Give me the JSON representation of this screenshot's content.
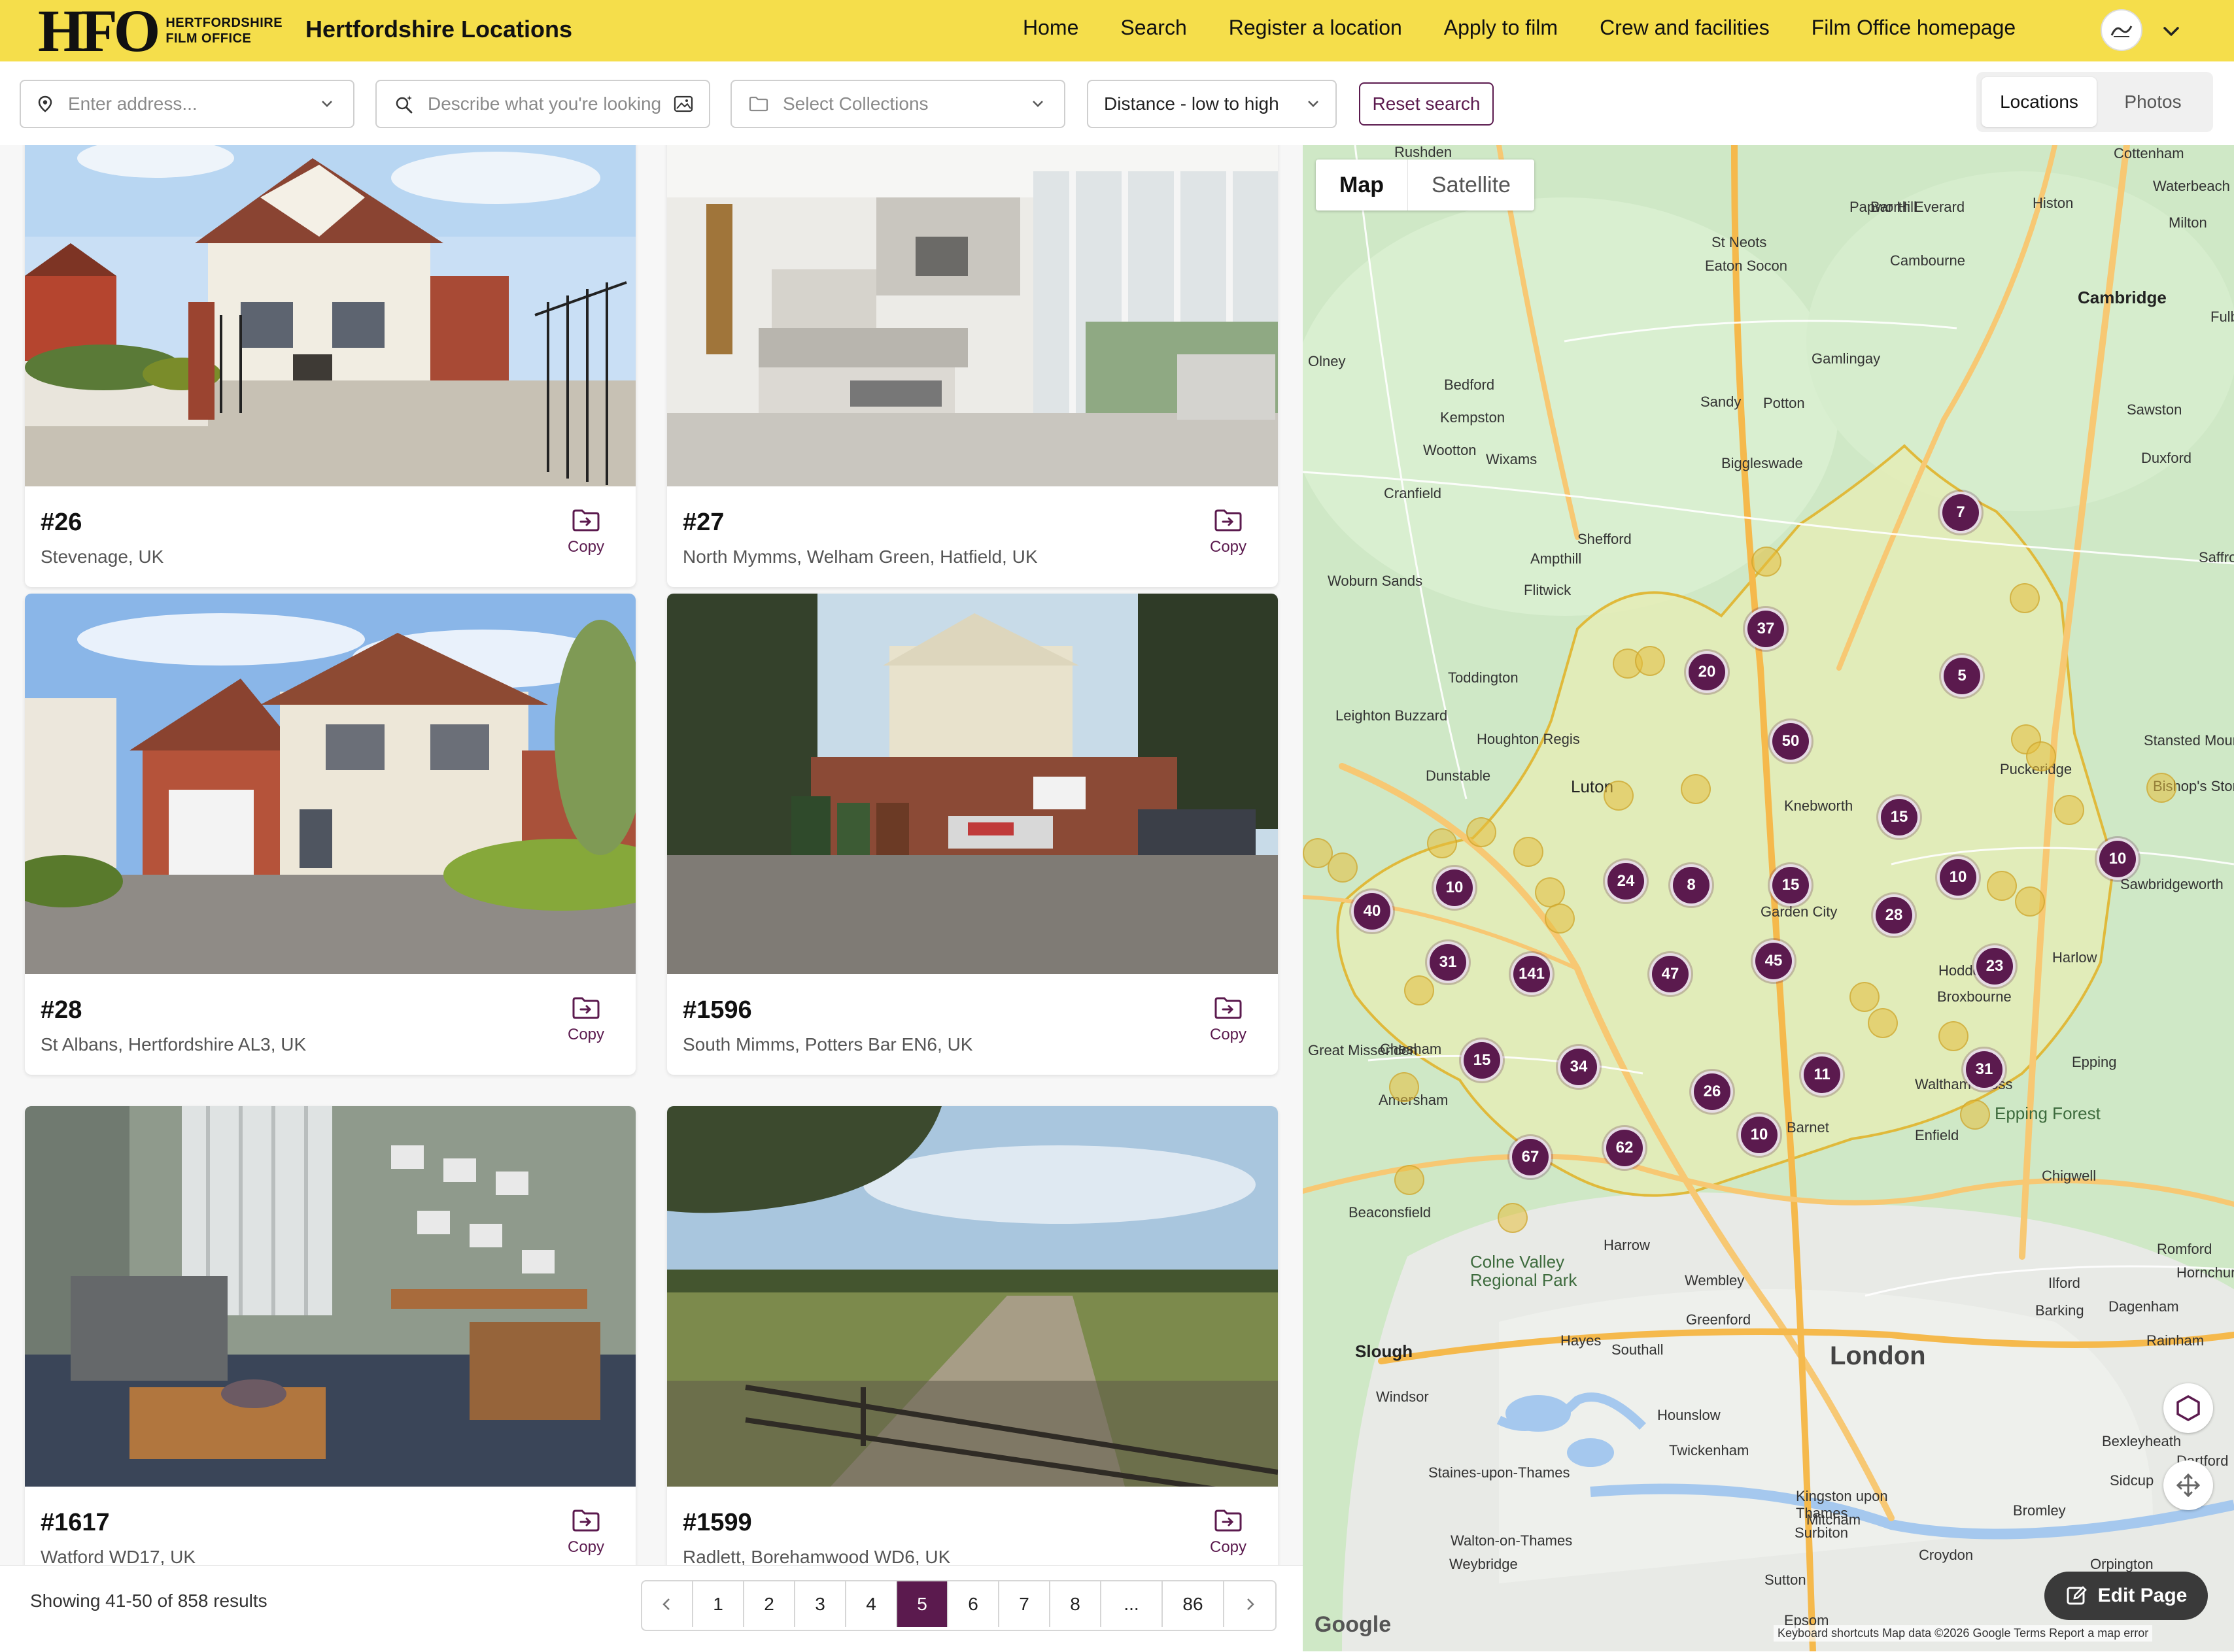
{
  "header": {
    "logo_mark": "HFO",
    "logo_text_1": "HERTFORDSHIRE",
    "logo_text_2": "FILM OFFICE",
    "title": "Hertfordshire Locations",
    "nav": [
      "Home",
      "Search",
      "Register a location",
      "Apply to film",
      "Crew and facilities",
      "Film Office homepage"
    ]
  },
  "filters": {
    "address_placeholder": "Enter address...",
    "describe_placeholder": "Describe what you're looking for",
    "collections_placeholder": "Select Collections",
    "sort_value": "Distance - low to high",
    "reset_label": "Reset search",
    "view_options": [
      "Locations",
      "Photos"
    ],
    "view_selected": "Locations"
  },
  "cards": [
    {
      "id": "#26",
      "location": "Stevenage, UK",
      "copy": "Copy"
    },
    {
      "id": "#27",
      "location": "North Mymms, Welham Green, Hatfield, UK",
      "copy": "Copy"
    },
    {
      "id": "#28",
      "location": "St Albans, Hertfordshire AL3, UK",
      "copy": "Copy"
    },
    {
      "id": "#1596",
      "location": "South Mimms, Potters Bar EN6, UK",
      "copy": "Copy"
    },
    {
      "id": "#1617",
      "location": "Watford WD17, UK",
      "copy": "Copy"
    },
    {
      "id": "#1599",
      "location": "Radlett, Borehamwood WD6, UK",
      "copy": "Copy"
    }
  ],
  "pagination": {
    "summary": "Showing 41-50 of 858 results",
    "pages": [
      "1",
      "2",
      "3",
      "4",
      "5",
      "6",
      "7",
      "8",
      "...",
      "86"
    ],
    "current": "5"
  },
  "map": {
    "tabs": [
      "Map",
      "Satellite"
    ],
    "selected_tab": "Map",
    "places": [
      "Rushden",
      "Cottenham",
      "Waterbeach",
      "Papworth Everard",
      "Bar Hill",
      "Histon",
      "Milton",
      "St Neots",
      "Eaton Socon",
      "Cambourne",
      "Cambridge",
      "Fulbourn",
      "Olney",
      "Gamlingay",
      "Bedford",
      "Kempston",
      "Sandy",
      "Potton",
      "Sawston",
      "Wootton",
      "Wixams",
      "Biggleswade",
      "Duxford",
      "Cranfield",
      "Shefford",
      "Ampthill",
      "Flitwick",
      "Woburn Sands",
      "Saffron Walden",
      "Toddington",
      "Leighton Buzzard",
      "Houghton Regis",
      "Dunstable",
      "Luton",
      "Knebworth",
      "Puckeridge",
      "Stansted Mountfitchet",
      "Bishop's Stortford",
      "Sawbridgeworth",
      "Harlow",
      "Hoddesdon",
      "Broxbourne",
      "Garden City",
      "Epping",
      "Waltham Cross",
      "Epping Forest",
      "Great Missenden",
      "Chesham",
      "Amersham",
      "Barnet",
      "Enfield",
      "Chigwell",
      "Beaconsfield",
      "Harrow",
      "Wembley",
      "Romford",
      "Hornchurch",
      "Ilford",
      "Barking",
      "Dagenham",
      "Colne Valley Regional Park",
      "Greenford",
      "Hayes",
      "Southall",
      "Slough",
      "London",
      "Rainham",
      "Windsor",
      "Hounslow",
      "Twickenham",
      "Bexleyheath",
      "Dartford",
      "Staines-upon-Thames",
      "Kingston upon Thames",
      "Surbiton",
      "Mitcham",
      "Bromley",
      "Sidcup",
      "Walton-on-Thames",
      "Weybridge",
      "Croydon",
      "Sutton",
      "Orpington",
      "Epsom"
    ],
    "clusters": [
      "7",
      "37",
      "20",
      "5",
      "50",
      "15",
      "10",
      "10",
      "40",
      "10",
      "24",
      "8",
      "15",
      "28",
      "31",
      "141",
      "47",
      "45",
      "23",
      "15",
      "34",
      "26",
      "11",
      "31",
      "10",
      "67",
      "62"
    ],
    "google": "Google",
    "attribution": "Keyboard shortcuts   Map data ©2026 Google   Terms   Report a map error",
    "edit_label": "Edit Page"
  },
  "colors": {
    "header_bg": "#f5de4b",
    "accent": "#5b1a4e",
    "map_land": "#cfe8c6"
  }
}
